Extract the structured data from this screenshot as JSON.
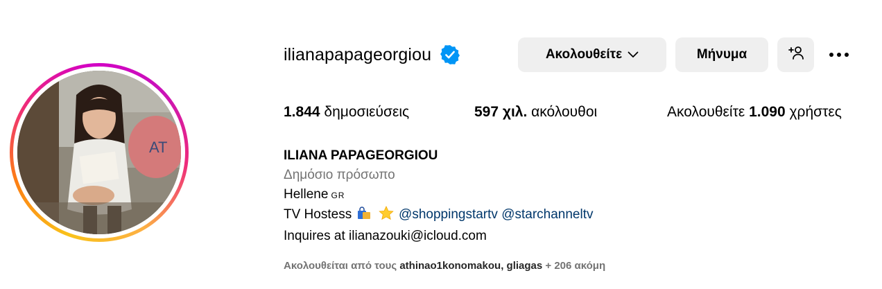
{
  "profile": {
    "username": "ilianapapageorgiou",
    "verified_icon": "verified-badge-icon",
    "verified_color": "#0095f6"
  },
  "actions": {
    "follow_label": "Ακολουθείτε",
    "message_label": "Μήνυμα",
    "add_user_icon": "add-user-icon",
    "more_icon": "more-options-icon"
  },
  "stats": {
    "posts_count": "1.844",
    "posts_label": "δημοσιεύσεις",
    "followers_count": "597 χιλ.",
    "followers_label": "ακόλουθοι",
    "following_prefix": "Ακολουθείτε",
    "following_count": "1.090",
    "following_label": "χρήστες"
  },
  "bio": {
    "full_name": "ILIANA PAPAGEORGIOU",
    "category": "Δημόσιο πρόσωπο",
    "line1_text": "Hellene",
    "line1_flag": "GR",
    "line2_text": "TV Hostess",
    "line2_emoji1": "shopping-bags-icon",
    "line2_emoji2": "star-icon",
    "mention1": "@shoppingstartv",
    "mention2": "@starchanneltv",
    "line3": "Inquires at ilianazouki@icloud.com"
  },
  "followed_by": {
    "prefix": "Ακολουθείται από τους",
    "account1": "athinao1konomakou",
    "separator": ",",
    "account2": "gliagas",
    "more": "+ 206 ακόμη"
  },
  "colors": {
    "button_bg": "#efefef",
    "secondary_text": "#737373",
    "link": "#00376b"
  }
}
